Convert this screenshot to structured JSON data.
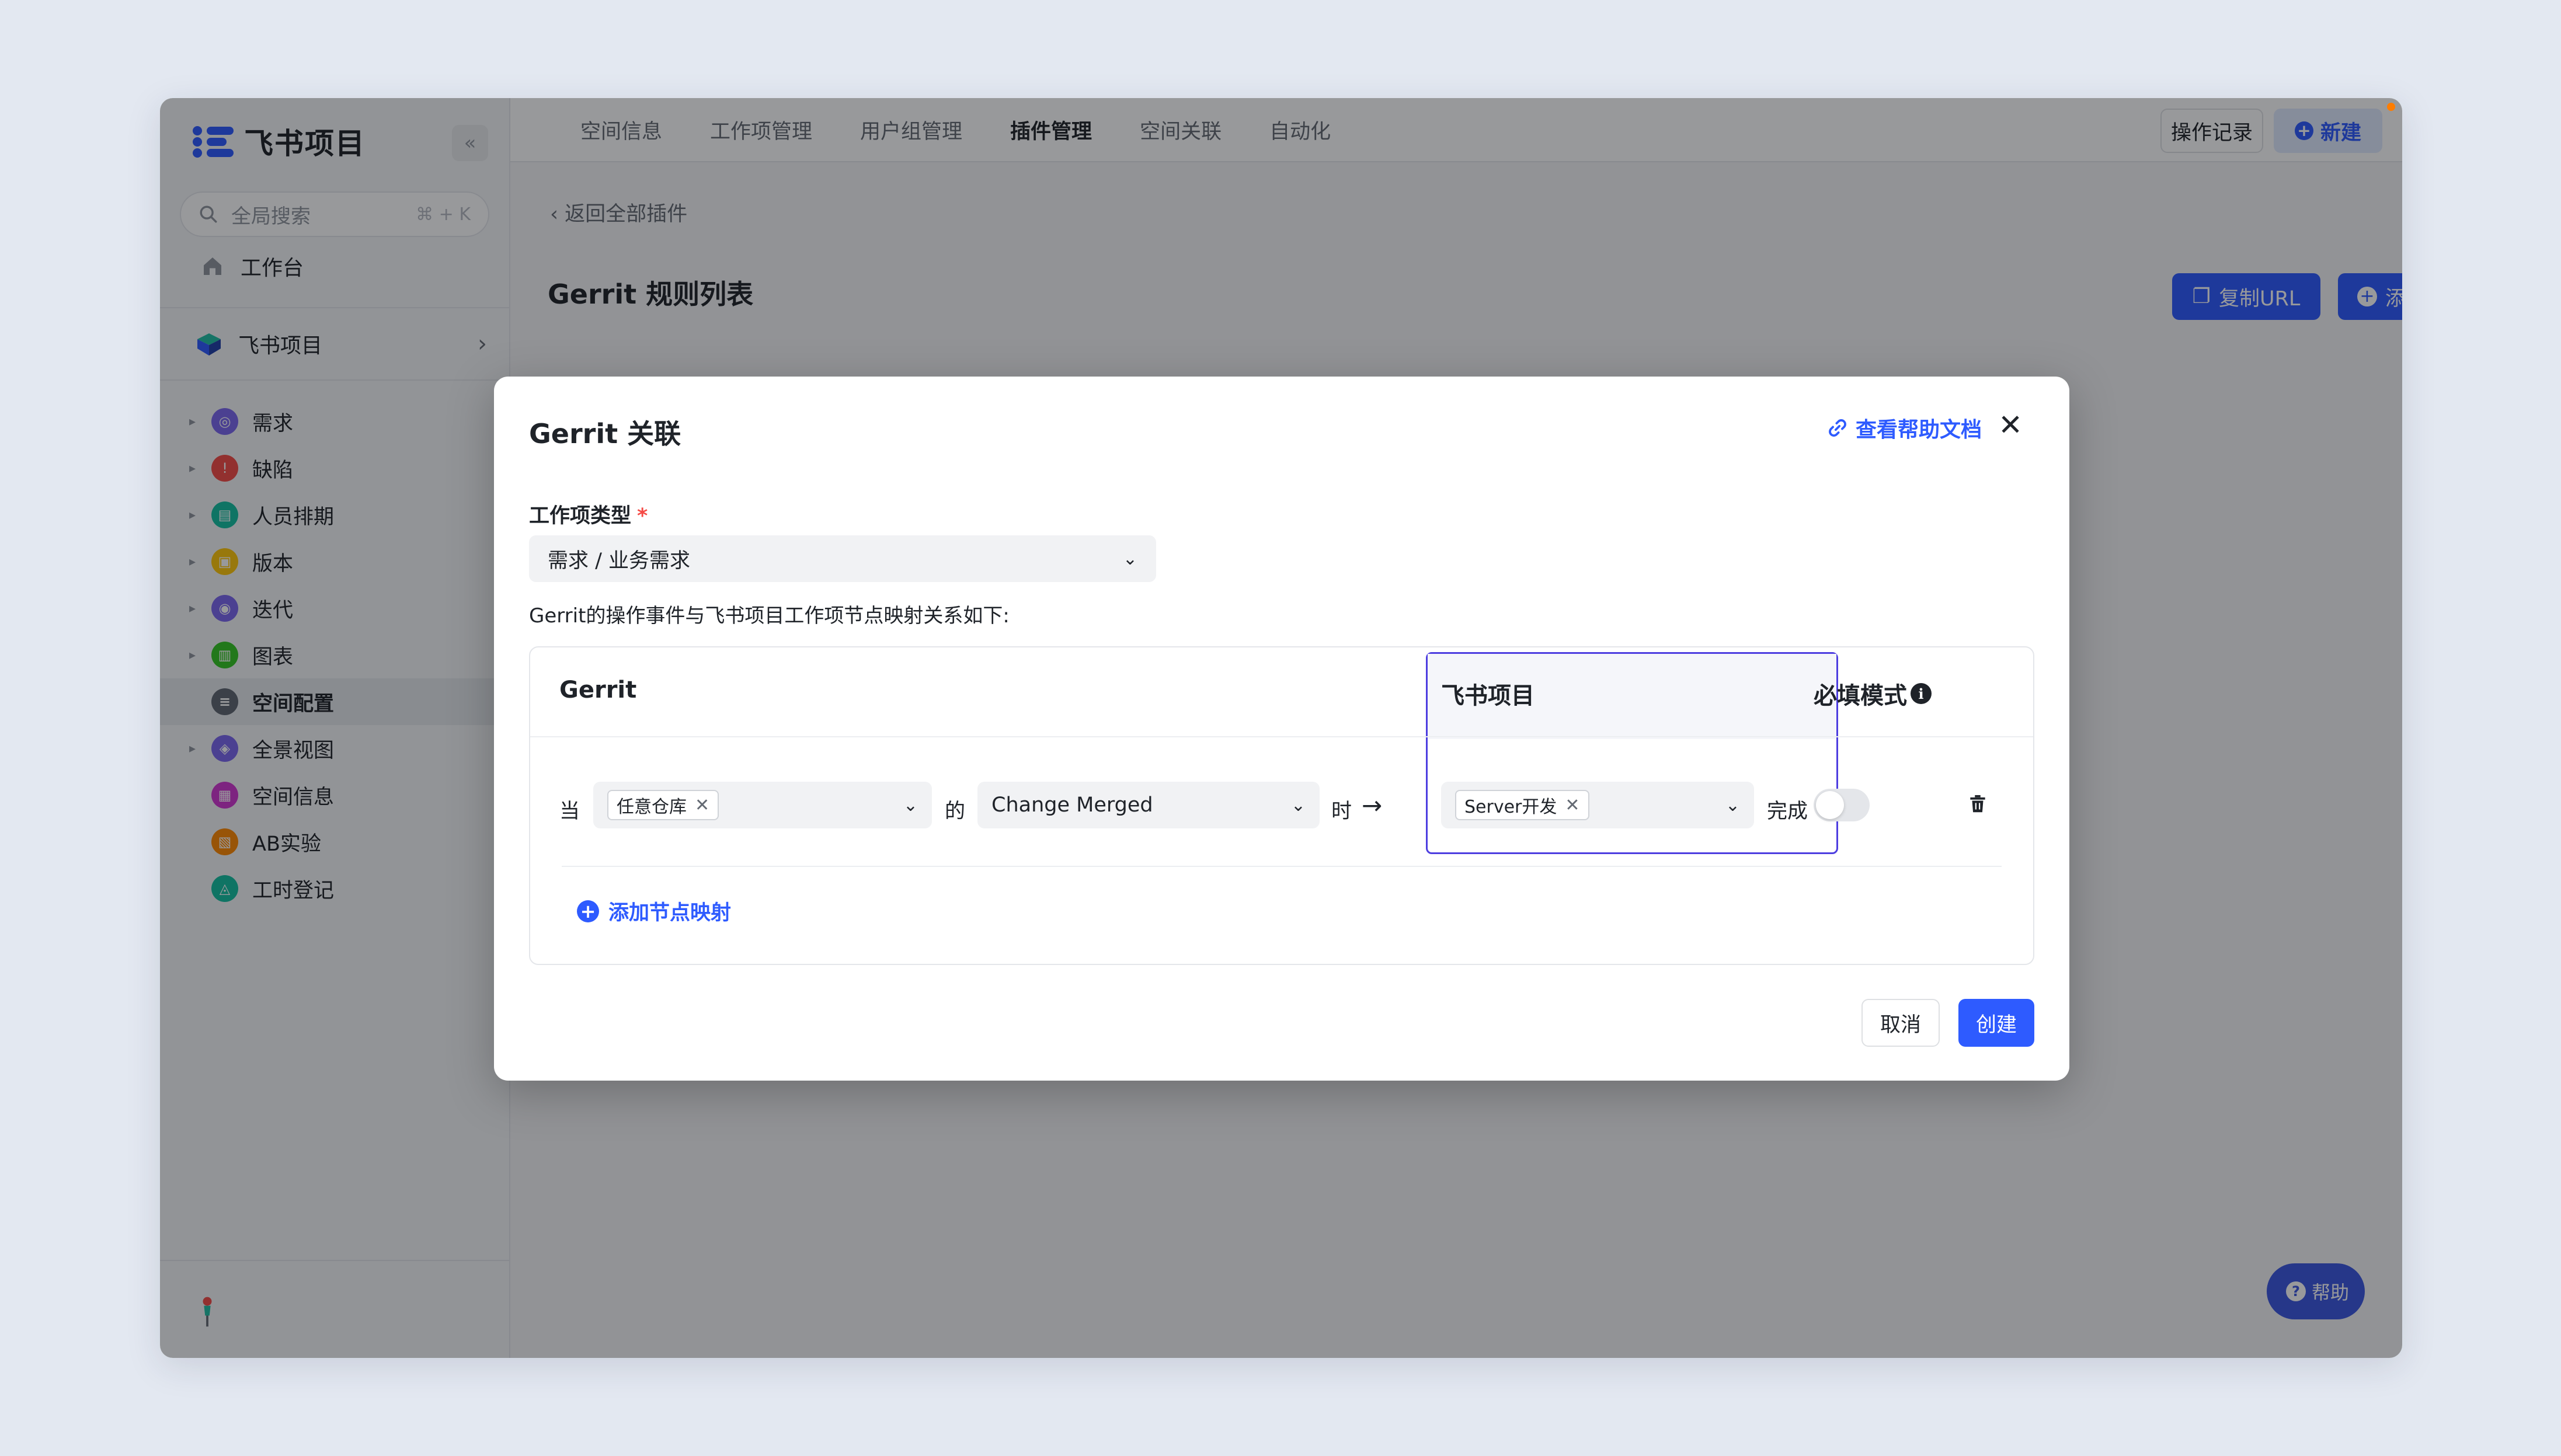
{
  "app": {
    "name": "飞书项目"
  },
  "sidebar": {
    "search_placeholder": "全局搜索",
    "search_shortcut": "⌘ + K",
    "workbench": "工作台",
    "space_name": "飞书项目",
    "items": [
      {
        "label": "需求",
        "color": "#7b67ee"
      },
      {
        "label": "缺陷",
        "color": "#f54a45"
      },
      {
        "label": "人员排期",
        "color": "#14c0a1"
      },
      {
        "label": "版本",
        "color": "#ffc60a"
      },
      {
        "label": "迭代",
        "color": "#7b67ee"
      },
      {
        "label": "图表",
        "color": "#34c724"
      },
      {
        "label": "空间配置",
        "color": "#5f6670"
      },
      {
        "label": "全景视图",
        "color": "#7b67ee"
      },
      {
        "label": "空间信息",
        "color": "#d136d1"
      },
      {
        "label": "AB实验",
        "color": "#ff8800"
      },
      {
        "label": "工时登记",
        "color": "#14c0a1"
      }
    ]
  },
  "topbar": {
    "tabs": [
      "空间信息",
      "工作项管理",
      "用户组管理",
      "插件管理",
      "空间关联",
      "自动化"
    ],
    "active_tab": "插件管理",
    "log_button": "操作记录",
    "new_button": "新建"
  },
  "page": {
    "back_link": "返回全部插件",
    "title": "Gerrit 规则列表",
    "copy_url_button": "复制URL",
    "add_rule_button": "添加流转规则",
    "help_fab": "帮助"
  },
  "modal": {
    "title": "Gerrit 关联",
    "help_link": "查看帮助文档",
    "type_label": "工作项类型",
    "type_required": "*",
    "type_value": "需求 / 业务需求",
    "description": "Gerrit的操作事件与飞书项目工作项节点映射关系如下:",
    "columns": {
      "gerrit": "Gerrit",
      "feishu": "飞书项目",
      "required": "必填模式"
    },
    "row": {
      "when": "当",
      "repo_chip": "任意仓库",
      "of": "的",
      "event": "Change Merged",
      "at": "时",
      "node_chip": "Server开发",
      "complete": "完成",
      "required_on": false
    },
    "add_mapping": "添加节点映射",
    "cancel": "取消",
    "create": "创建"
  },
  "colors": {
    "accent": "#2e5bff",
    "highlight_border": "#4d3ee0"
  }
}
